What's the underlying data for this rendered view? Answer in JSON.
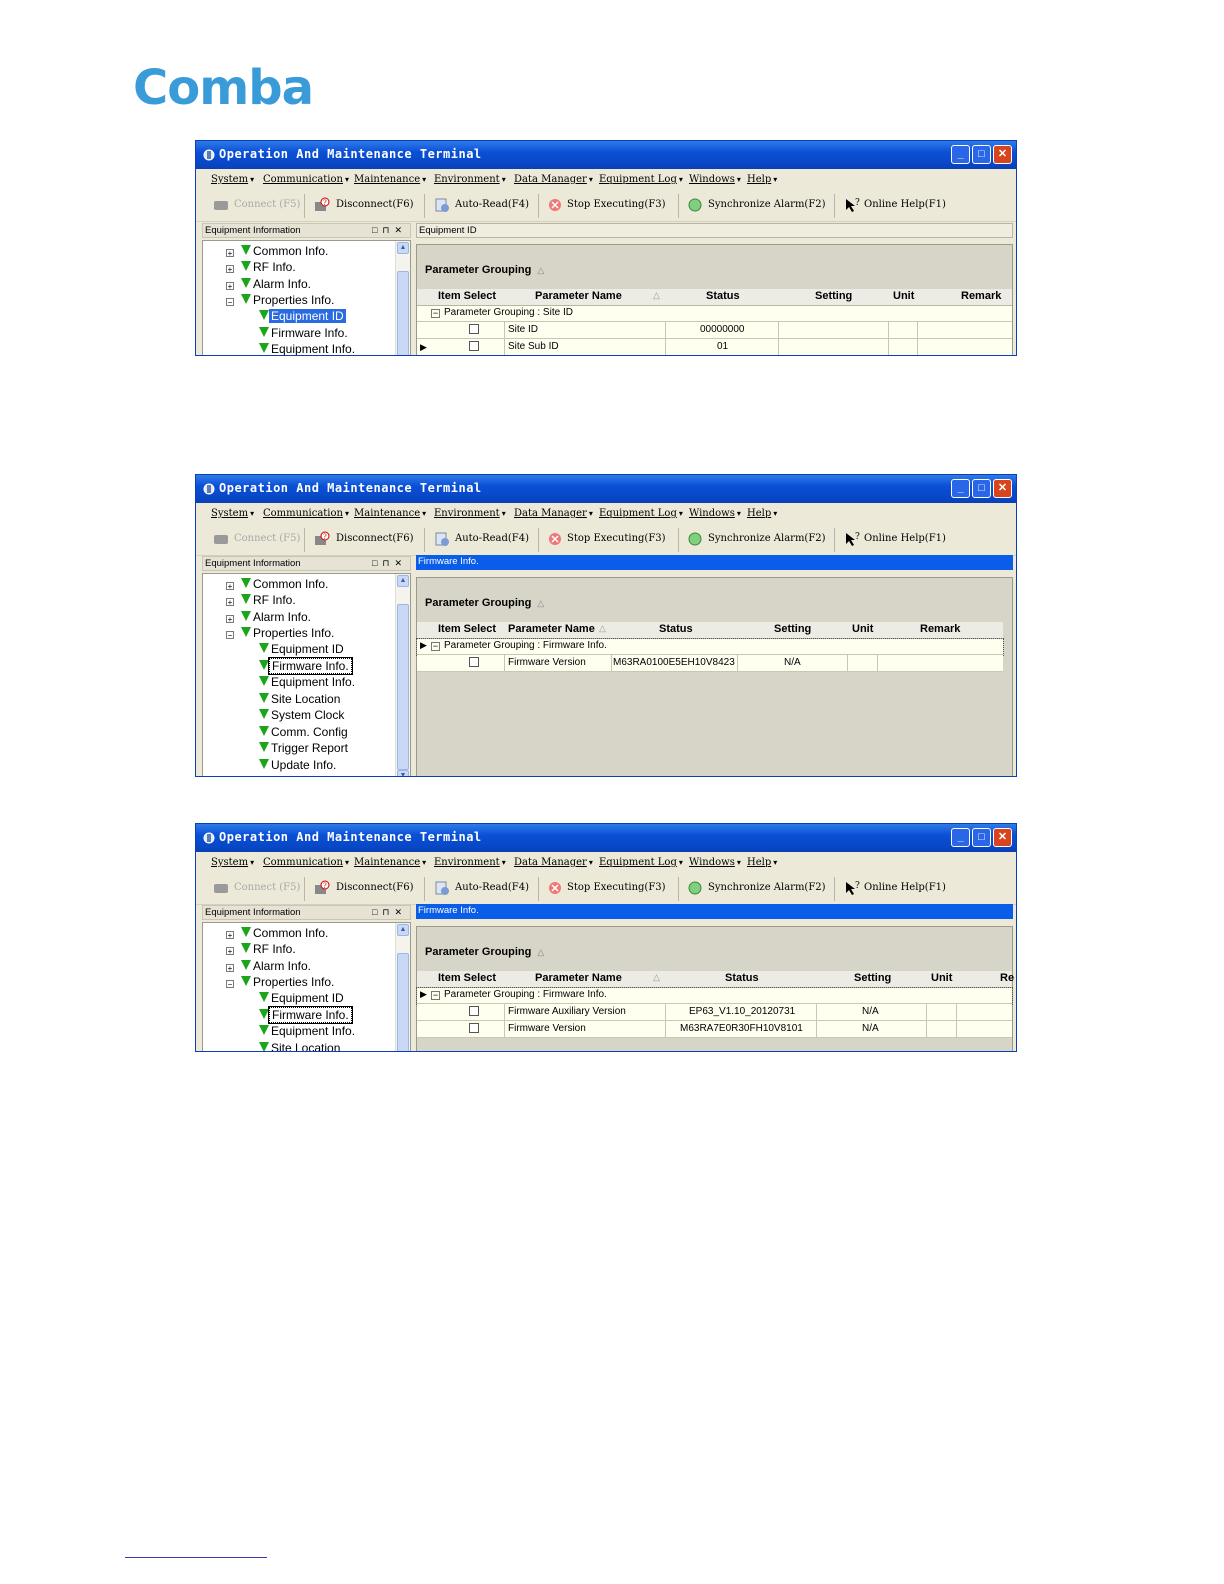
{
  "logo": "Comba",
  "app": {
    "title": "Operation And Maintenance Terminal",
    "menu": [
      "System",
      "Communication",
      "Maintenance",
      "Environment",
      "Data Manager",
      "Equipment Log",
      "Windows",
      "Help"
    ],
    "toolbar": {
      "connect": "Connect (F5)",
      "disconnect": "Disconnect(F6)",
      "auto_read": "Auto-Read(F4)",
      "stop": "Stop Executing(F3)",
      "sync": "Synchronize Alarm(F2)",
      "help": "Online Help(F1)"
    },
    "panel_title": "Equipment Information",
    "tree": [
      "Common Info.",
      "RF Info.",
      "Alarm Info.",
      "Properties Info.",
      "Equipment ID",
      "Firmware Info.",
      "Equipment Info.",
      "Site Location",
      "System Clock",
      "Comm. Config",
      "Trigger Report",
      "Update Info."
    ],
    "grid_group_label": "Parameter Grouping",
    "sort_mark": "△",
    "columns": [
      "Item Select",
      "Parameter Name",
      "Status",
      "Setting",
      "Unit",
      "Remark"
    ]
  },
  "screens": [
    {
      "header": "Equipment ID",
      "group": "Parameter Grouping : Site ID",
      "rows": [
        {
          "name": "Site ID",
          "status": "00000000",
          "setting": ""
        },
        {
          "name": "Site Sub ID",
          "status": "01",
          "setting": ""
        }
      ]
    },
    {
      "header": "Firmware Info.",
      "group": "Parameter Grouping : Firmware Info.",
      "rows": [
        {
          "name": "Firmware Version",
          "status": "M63RA0100E5EH10V8423",
          "setting": "N/A"
        }
      ]
    },
    {
      "header": "Firmware Info.",
      "group": "Parameter Grouping : Firmware Info.",
      "partial_remark": "Re",
      "rows": [
        {
          "name": "Firmware Auxiliary Version",
          "status": "EP63_V1.10_20120731",
          "setting": "N/A"
        },
        {
          "name": "Firmware Version",
          "status": "M63RA7E0R30FH10V8101",
          "setting": "N/A"
        }
      ]
    }
  ]
}
